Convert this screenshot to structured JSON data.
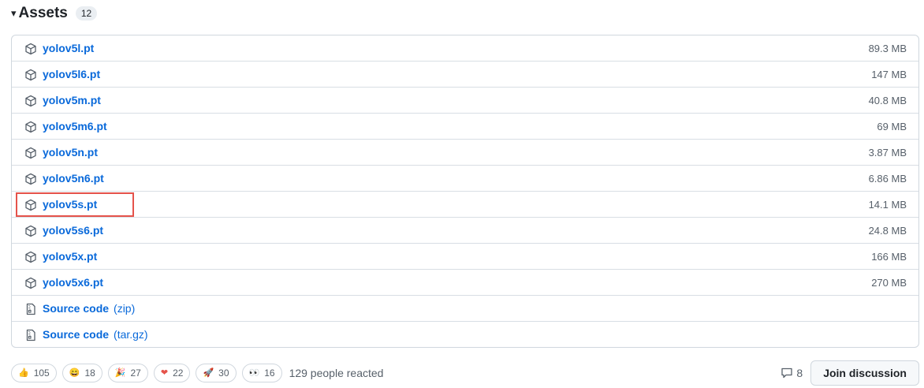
{
  "assets": {
    "title": "Assets",
    "count": "12",
    "files": [
      {
        "name": "yolov5l.pt",
        "size": "89.3 MB"
      },
      {
        "name": "yolov5l6.pt",
        "size": "147 MB"
      },
      {
        "name": "yolov5m.pt",
        "size": "40.8 MB"
      },
      {
        "name": "yolov5m6.pt",
        "size": "69 MB"
      },
      {
        "name": "yolov5n.pt",
        "size": "3.87 MB"
      },
      {
        "name": "yolov5n6.pt",
        "size": "6.86 MB"
      },
      {
        "name": "yolov5s.pt",
        "size": "14.1 MB"
      },
      {
        "name": "yolov5s6.pt",
        "size": "24.8 MB"
      },
      {
        "name": "yolov5x.pt",
        "size": "166 MB"
      },
      {
        "name": "yolov5x6.pt",
        "size": "270 MB"
      }
    ],
    "source": [
      {
        "name": "Source code",
        "suffix": "(zip)"
      },
      {
        "name": "Source code",
        "suffix": "(tar.gz)"
      }
    ]
  },
  "reactions": {
    "items": [
      {
        "emoji": "👍",
        "icon": "thumbs-up",
        "count": "105"
      },
      {
        "emoji": "😄",
        "icon": "laugh",
        "count": "18"
      },
      {
        "emoji": "🎉",
        "icon": "hooray",
        "count": "27"
      },
      {
        "emoji": "❤",
        "icon": "heart",
        "count": "22"
      },
      {
        "emoji": "🚀",
        "icon": "rocket",
        "count": "30"
      },
      {
        "emoji": "👀",
        "icon": "eyes",
        "count": "16"
      }
    ],
    "summary": "129 people reacted",
    "comments": "8",
    "join_label": "Join discussion"
  },
  "colors": {
    "link": "#0969da",
    "highlight": "#e5534b"
  }
}
